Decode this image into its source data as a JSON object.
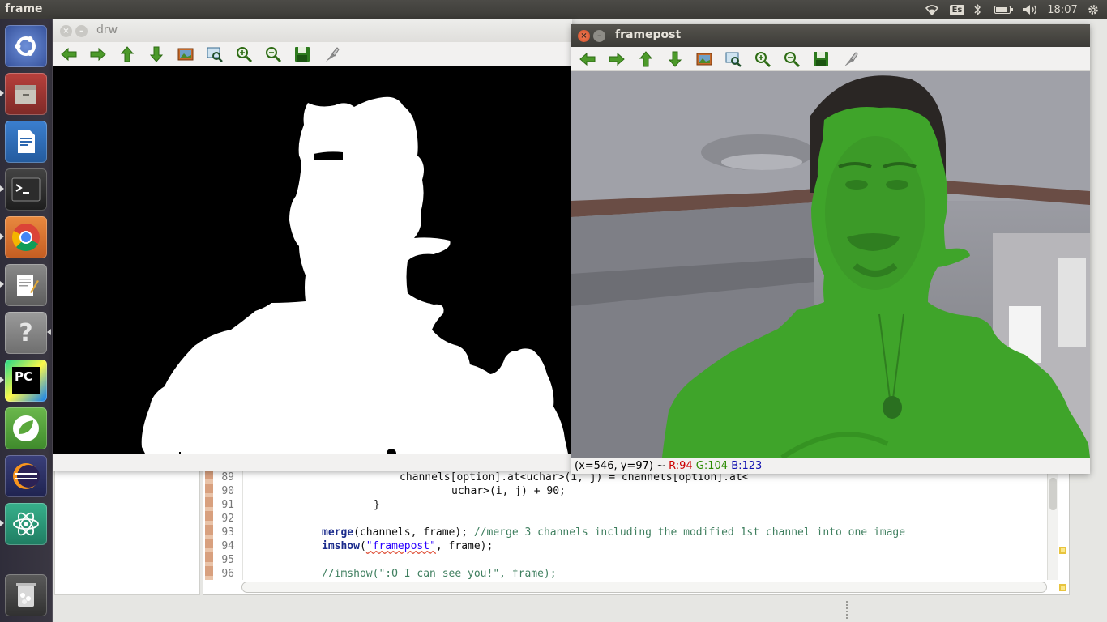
{
  "top_panel": {
    "app_name": "frame",
    "keyboard_layout": "Es",
    "clock": "18:07",
    "icons": [
      "wifi-icon",
      "bluetooth-icon",
      "battery-icon",
      "volume-icon",
      "gear-icon"
    ]
  },
  "launcher": {
    "items": [
      {
        "name": "ubuntu-dash-icon",
        "color": "#3a5fb5"
      },
      {
        "name": "files-icon",
        "color": "#a0302e"
      },
      {
        "name": "writer-icon",
        "color": "#2e68b4"
      },
      {
        "name": "terminal-icon",
        "color": "#2b2b2b"
      },
      {
        "name": "chrome-icon",
        "color": "#d7682c"
      },
      {
        "name": "text-editor-icon",
        "color": "#6c6c6c"
      },
      {
        "name": "help-icon",
        "color": "#8a8a8a"
      },
      {
        "name": "pycharm-icon",
        "color": "#3f8f3a"
      },
      {
        "name": "spring-icon",
        "color": "#4d9b3a"
      },
      {
        "name": "eclipse-icon",
        "color": "#c2462b"
      },
      {
        "name": "atom-icon",
        "color": "#2f9c7c"
      },
      {
        "name": "trash-icon",
        "color": "#4a4a4a"
      }
    ]
  },
  "windows": {
    "drw": {
      "title": "drw",
      "toolbar": [
        "back-arrow-icon",
        "forward-arrow-icon",
        "up-arrow-icon",
        "down-arrow-icon",
        "image-icon",
        "zoom-fit-icon",
        "zoom-in-icon",
        "zoom-out-icon",
        "save-icon",
        "properties-icon"
      ]
    },
    "framepost": {
      "title": "framepost",
      "toolbar": [
        "back-arrow-icon",
        "forward-arrow-icon",
        "up-arrow-icon",
        "down-arrow-icon",
        "image-icon",
        "zoom-fit-icon",
        "zoom-in-icon",
        "zoom-out-icon",
        "save-icon",
        "properties-icon"
      ],
      "status": {
        "coords": "(x=546, y=97) ~ ",
        "r": "R:94",
        "g": "G:104",
        "b": "B:123"
      }
    }
  },
  "editor": {
    "lines": [
      {
        "num": "89",
        "text": "channels[option].at<uchar>(i, j) = channels[option].at<"
      },
      {
        "num": "90",
        "text": "uchar>(i, j) + 90;"
      },
      {
        "num": "91",
        "text": "}"
      },
      {
        "num": "92",
        "text": ""
      },
      {
        "num": "93",
        "kw": "merge",
        "rest": "(channels, frame); ",
        "comment": "//merge 3 channels including the modified 1st channel into one image"
      },
      {
        "num": "94",
        "kw": "imshow",
        "open": "(",
        "str": "\"framepost\"",
        "rest": ", frame);"
      },
      {
        "num": "95",
        "text": ""
      },
      {
        "num": "96",
        "comment": "//imshow(\":O I can see you!\", frame);"
      }
    ]
  },
  "colors": {
    "overlay_green": "#3fa42a",
    "status_r": "#cc0000",
    "status_g": "#2a8a00",
    "status_b": "#1010b0"
  }
}
